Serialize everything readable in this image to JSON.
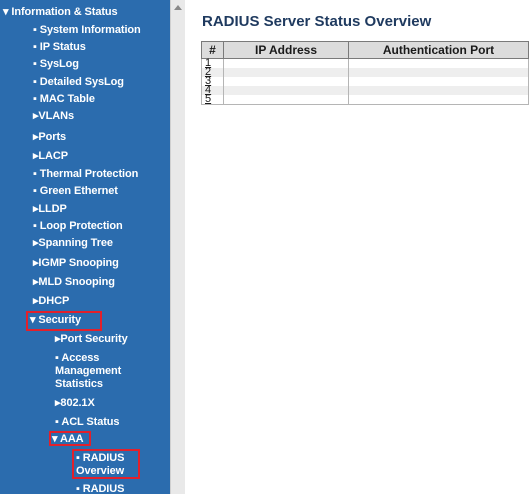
{
  "sidebar": {
    "section": "▾ Information & Status",
    "items": [
      "▪ System Information",
      "▪ IP Status",
      "▪ SysLog",
      "▪ Detailed SysLog",
      "▪ MAC Table",
      "▸VLANs",
      "▸Ports",
      "▸LACP",
      "▪ Thermal Protection",
      "▪ Green Ethernet",
      "▸LLDP",
      "▪ Loop Protection",
      "▸Spanning Tree",
      "▸IGMP Snooping",
      "▸MLD Snooping",
      "▸DHCP"
    ],
    "security": "▾ Security",
    "port_security": "▸Port Security",
    "access_management": "▪ Access Management Statistics",
    "dot1x": "▸802.1X",
    "acl_status": "▪ ACL Status",
    "aaa": "▾ AAA",
    "radius_overview": "▪ RADIUS Overview",
    "radius_details": "▪ RADIUS"
  },
  "main": {
    "title": "RADIUS Server Status Overview",
    "columns": [
      "#",
      "IP Address",
      "Authentication Port"
    ],
    "rows": [
      "1",
      "2",
      "3",
      "4",
      "5"
    ]
  },
  "colors": {
    "sidebar_bg": "#2b6cae",
    "highlight": "#e2202b",
    "title": "#1f3a5f"
  }
}
